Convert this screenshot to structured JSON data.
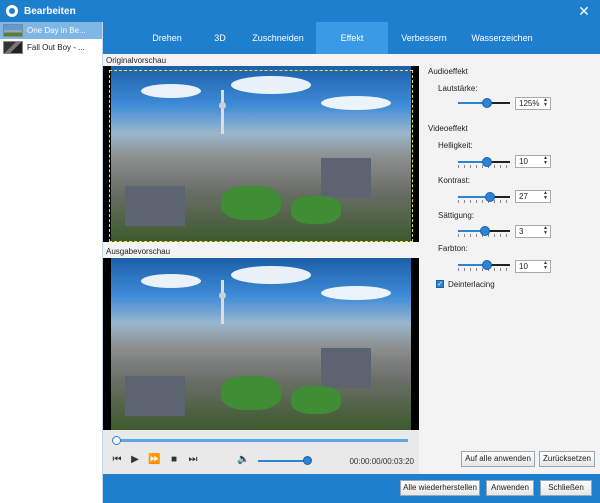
{
  "window": {
    "title": "Bearbeiten",
    "close_glyph": "✕"
  },
  "sidebar": {
    "files": [
      {
        "name": "One Day in Be...",
        "thumb": "city",
        "selected": true
      },
      {
        "name": "Fall Out Boy - ...",
        "thumb": "dark",
        "selected": false
      }
    ]
  },
  "tabs": [
    {
      "label": "Drehen",
      "active": false
    },
    {
      "label": "3D",
      "active": false
    },
    {
      "label": "Zuschneiden",
      "active": false
    },
    {
      "label": "Effekt",
      "active": true
    },
    {
      "label": "Verbessern",
      "active": false
    },
    {
      "label": "Wasserzeichen",
      "active": false
    }
  ],
  "preview": {
    "original_label": "Originalvorschau",
    "output_label": "Ausgabevorschau",
    "time": "00:00:00/00:03:20",
    "progress": 0.0,
    "volume": 1.0,
    "controls": [
      {
        "name": "previous-icon",
        "glyph": "⏮"
      },
      {
        "name": "play-icon",
        "glyph": "▶"
      },
      {
        "name": "fast-forward-icon",
        "glyph": "⏩"
      },
      {
        "name": "stop-icon",
        "glyph": "■"
      },
      {
        "name": "next-icon",
        "glyph": "⏭"
      }
    ],
    "volume_icon": "🔈"
  },
  "effects": {
    "audio_title": "Audioeffekt",
    "volume_label": "Lautstärke:",
    "volume_value": "125%",
    "volume_level": 0.56,
    "video_title": "Videoeffekt",
    "params": [
      {
        "label": "Helligkeit:",
        "value": "10",
        "level": 0.55
      },
      {
        "label": "Kontrast:",
        "value": "27",
        "level": 0.62
      },
      {
        "label": "Sättigung:",
        "value": "3",
        "level": 0.52
      },
      {
        "label": "Farbton:",
        "value": "10",
        "level": 0.55
      }
    ],
    "deinterlacing_label": "Deinterlacing",
    "deinterlacing_checked": true,
    "check_glyph": "✓"
  },
  "panel_buttons": {
    "apply_all": "Auf alle anwenden",
    "reset": "Zurücksetzen"
  },
  "footer_buttons": {
    "restore_all": "Alle wiederherstellen",
    "apply": "Anwenden",
    "close": "Schließen"
  },
  "colors": {
    "accent": "#1f7fcf",
    "slider": "#2b84d6",
    "crop": "#e9e534"
  }
}
